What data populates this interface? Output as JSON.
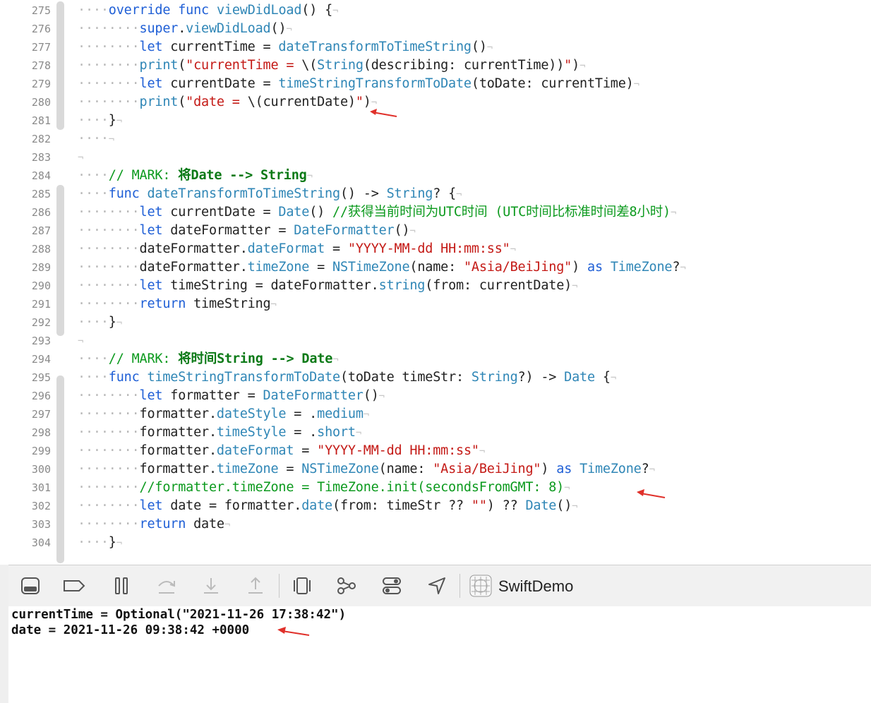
{
  "editor": {
    "lines": [
      {
        "n": "275",
        "tokens": [
          {
            "t": "····",
            "k": "ws"
          },
          {
            "t": "override",
            "k": "kw"
          },
          {
            "t": " ",
            "k": "pl"
          },
          {
            "t": "func",
            "k": "kw"
          },
          {
            "t": " ",
            "k": "pl"
          },
          {
            "t": "viewDidLoad",
            "k": "fn"
          },
          {
            "t": "() {",
            "k": "pl"
          },
          {
            "t": "¬",
            "k": "nl"
          }
        ]
      },
      {
        "n": "276",
        "tokens": [
          {
            "t": "········",
            "k": "ws"
          },
          {
            "t": "super",
            "k": "kw"
          },
          {
            "t": ".",
            "k": "pl"
          },
          {
            "t": "viewDidLoad",
            "k": "fn"
          },
          {
            "t": "()",
            "k": "pl"
          },
          {
            "t": "¬",
            "k": "nl"
          }
        ]
      },
      {
        "n": "277",
        "tokens": [
          {
            "t": "········",
            "k": "ws"
          },
          {
            "t": "let",
            "k": "kw"
          },
          {
            "t": " currentTime = ",
            "k": "pl"
          },
          {
            "t": "dateTransformToTimeString",
            "k": "fn"
          },
          {
            "t": "()",
            "k": "pl"
          },
          {
            "t": "¬",
            "k": "nl"
          }
        ]
      },
      {
        "n": "278",
        "tokens": [
          {
            "t": "········",
            "k": "ws"
          },
          {
            "t": "print",
            "k": "fn"
          },
          {
            "t": "(",
            "k": "pl"
          },
          {
            "t": "\"currentTime = ",
            "k": "str"
          },
          {
            "t": "\\(",
            "k": "pl"
          },
          {
            "t": "String",
            "k": "ty"
          },
          {
            "t": "(describing: currentTime))",
            "k": "pl"
          },
          {
            "t": "\"",
            "k": "str"
          },
          {
            "t": ")",
            "k": "pl"
          },
          {
            "t": "¬",
            "k": "nl"
          }
        ]
      },
      {
        "n": "279",
        "tokens": [
          {
            "t": "········",
            "k": "ws"
          },
          {
            "t": "let",
            "k": "kw"
          },
          {
            "t": " currentDate = ",
            "k": "pl"
          },
          {
            "t": "timeStringTransformToDate",
            "k": "fn"
          },
          {
            "t": "(toDate: currentTime)",
            "k": "pl"
          },
          {
            "t": "¬",
            "k": "nl"
          }
        ]
      },
      {
        "n": "280",
        "tokens": [
          {
            "t": "········",
            "k": "ws"
          },
          {
            "t": "print",
            "k": "fn"
          },
          {
            "t": "(",
            "k": "pl"
          },
          {
            "t": "\"date = ",
            "k": "str"
          },
          {
            "t": "\\(currentDate)",
            "k": "pl"
          },
          {
            "t": "\"",
            "k": "str"
          },
          {
            "t": ")",
            "k": "pl"
          },
          {
            "t": "¬",
            "k": "nl"
          }
        ]
      },
      {
        "n": "281",
        "tokens": [
          {
            "t": "····",
            "k": "ws"
          },
          {
            "t": "}",
            "k": "pl"
          },
          {
            "t": "¬",
            "k": "nl"
          }
        ]
      },
      {
        "n": "282",
        "tokens": [
          {
            "t": "····",
            "k": "ws"
          },
          {
            "t": "¬",
            "k": "nl"
          }
        ]
      },
      {
        "n": "283",
        "tokens": [
          {
            "t": "¬",
            "k": "nl"
          }
        ]
      },
      {
        "n": "284",
        "tokens": [
          {
            "t": "····",
            "k": "ws"
          },
          {
            "t": "// MARK: ",
            "k": "cm"
          },
          {
            "t": "将Date --> String",
            "k": "mk"
          },
          {
            "t": "¬",
            "k": "nl"
          }
        ]
      },
      {
        "n": "285",
        "tokens": [
          {
            "t": "····",
            "k": "ws"
          },
          {
            "t": "func",
            "k": "kw"
          },
          {
            "t": " ",
            "k": "pl"
          },
          {
            "t": "dateTransformToTimeString",
            "k": "fn"
          },
          {
            "t": "() -> ",
            "k": "pl"
          },
          {
            "t": "String",
            "k": "ty"
          },
          {
            "t": "? {",
            "k": "pl"
          },
          {
            "t": "¬",
            "k": "nl"
          }
        ]
      },
      {
        "n": "286",
        "tokens": [
          {
            "t": "········",
            "k": "ws"
          },
          {
            "t": "let",
            "k": "kw"
          },
          {
            "t": " currentDate = ",
            "k": "pl"
          },
          {
            "t": "Date",
            "k": "ty"
          },
          {
            "t": "() ",
            "k": "pl"
          },
          {
            "t": "//获得当前时间为UTC时间 (UTC时间比标准时间差8小时)",
            "k": "cm"
          },
          {
            "t": "¬",
            "k": "nl"
          }
        ]
      },
      {
        "n": "287",
        "tokens": [
          {
            "t": "········",
            "k": "ws"
          },
          {
            "t": "let",
            "k": "kw"
          },
          {
            "t": " dateFormatter = ",
            "k": "pl"
          },
          {
            "t": "DateFormatter",
            "k": "ty"
          },
          {
            "t": "()",
            "k": "pl"
          },
          {
            "t": "¬",
            "k": "nl"
          }
        ]
      },
      {
        "n": "288",
        "tokens": [
          {
            "t": "········",
            "k": "ws"
          },
          {
            "t": "dateFormatter.",
            "k": "pl"
          },
          {
            "t": "dateFormat",
            "k": "fn"
          },
          {
            "t": " = ",
            "k": "pl"
          },
          {
            "t": "\"YYYY-MM-dd HH:mm:ss\"",
            "k": "str"
          },
          {
            "t": "¬",
            "k": "nl"
          }
        ]
      },
      {
        "n": "289",
        "tokens": [
          {
            "t": "········",
            "k": "ws"
          },
          {
            "t": "dateFormatter.",
            "k": "pl"
          },
          {
            "t": "timeZone",
            "k": "fn"
          },
          {
            "t": " = ",
            "k": "pl"
          },
          {
            "t": "NSTimeZone",
            "k": "ty"
          },
          {
            "t": "(name: ",
            "k": "pl"
          },
          {
            "t": "\"Asia/BeiJing\"",
            "k": "str"
          },
          {
            "t": ") ",
            "k": "pl"
          },
          {
            "t": "as",
            "k": "kw"
          },
          {
            "t": " ",
            "k": "pl"
          },
          {
            "t": "TimeZone",
            "k": "ty"
          },
          {
            "t": "?",
            "k": "pl"
          },
          {
            "t": "¬",
            "k": "nl"
          }
        ]
      },
      {
        "n": "290",
        "tokens": [
          {
            "t": "········",
            "k": "ws"
          },
          {
            "t": "let",
            "k": "kw"
          },
          {
            "t": " timeString = dateFormatter.",
            "k": "pl"
          },
          {
            "t": "string",
            "k": "fn"
          },
          {
            "t": "(from: currentDate)",
            "k": "pl"
          },
          {
            "t": "¬",
            "k": "nl"
          }
        ]
      },
      {
        "n": "291",
        "tokens": [
          {
            "t": "········",
            "k": "ws"
          },
          {
            "t": "return",
            "k": "kw"
          },
          {
            "t": " timeString",
            "k": "pl"
          },
          {
            "t": "¬",
            "k": "nl"
          }
        ]
      },
      {
        "n": "292",
        "tokens": [
          {
            "t": "····",
            "k": "ws"
          },
          {
            "t": "}",
            "k": "pl"
          },
          {
            "t": "¬",
            "k": "nl"
          }
        ]
      },
      {
        "n": "293",
        "tokens": [
          {
            "t": "¬",
            "k": "nl"
          }
        ]
      },
      {
        "n": "294",
        "tokens": [
          {
            "t": "····",
            "k": "ws"
          },
          {
            "t": "// MARK: ",
            "k": "cm"
          },
          {
            "t": "将时间String --> Date",
            "k": "mk"
          },
          {
            "t": "¬",
            "k": "nl"
          }
        ]
      },
      {
        "n": "295",
        "tokens": [
          {
            "t": "····",
            "k": "ws"
          },
          {
            "t": "func",
            "k": "kw"
          },
          {
            "t": " ",
            "k": "pl"
          },
          {
            "t": "timeStringTransformToDate",
            "k": "fn"
          },
          {
            "t": "(toDate timeStr: ",
            "k": "pl"
          },
          {
            "t": "String",
            "k": "ty"
          },
          {
            "t": "?) -> ",
            "k": "pl"
          },
          {
            "t": "Date",
            "k": "ty"
          },
          {
            "t": " {",
            "k": "pl"
          },
          {
            "t": "¬",
            "k": "nl"
          }
        ]
      },
      {
        "n": "296",
        "tokens": [
          {
            "t": "········",
            "k": "ws"
          },
          {
            "t": "let",
            "k": "kw"
          },
          {
            "t": " formatter = ",
            "k": "pl"
          },
          {
            "t": "DateFormatter",
            "k": "ty"
          },
          {
            "t": "()",
            "k": "pl"
          },
          {
            "t": "¬",
            "k": "nl"
          }
        ]
      },
      {
        "n": "297",
        "tokens": [
          {
            "t": "········",
            "k": "ws"
          },
          {
            "t": "formatter.",
            "k": "pl"
          },
          {
            "t": "dateStyle",
            "k": "fn"
          },
          {
            "t": " = .",
            "k": "pl"
          },
          {
            "t": "medium",
            "k": "fn"
          },
          {
            "t": "¬",
            "k": "nl"
          }
        ]
      },
      {
        "n": "298",
        "tokens": [
          {
            "t": "········",
            "k": "ws"
          },
          {
            "t": "formatter.",
            "k": "pl"
          },
          {
            "t": "timeStyle",
            "k": "fn"
          },
          {
            "t": " = .",
            "k": "pl"
          },
          {
            "t": "short",
            "k": "fn"
          },
          {
            "t": "¬",
            "k": "nl"
          }
        ]
      },
      {
        "n": "299",
        "tokens": [
          {
            "t": "········",
            "k": "ws"
          },
          {
            "t": "formatter.",
            "k": "pl"
          },
          {
            "t": "dateFormat",
            "k": "fn"
          },
          {
            "t": " = ",
            "k": "pl"
          },
          {
            "t": "\"YYYY-MM-dd HH:mm:ss\"",
            "k": "str"
          },
          {
            "t": "¬",
            "k": "nl"
          }
        ]
      },
      {
        "n": "300",
        "tokens": [
          {
            "t": "········",
            "k": "ws"
          },
          {
            "t": "formatter.",
            "k": "pl"
          },
          {
            "t": "timeZone",
            "k": "fn"
          },
          {
            "t": " = ",
            "k": "pl"
          },
          {
            "t": "NSTimeZone",
            "k": "ty"
          },
          {
            "t": "(name: ",
            "k": "pl"
          },
          {
            "t": "\"Asia/BeiJing\"",
            "k": "str"
          },
          {
            "t": ") ",
            "k": "pl"
          },
          {
            "t": "as",
            "k": "kw"
          },
          {
            "t": " ",
            "k": "pl"
          },
          {
            "t": "TimeZone",
            "k": "ty"
          },
          {
            "t": "?",
            "k": "pl"
          },
          {
            "t": "¬",
            "k": "nl"
          }
        ]
      },
      {
        "n": "301",
        "tokens": [
          {
            "t": "········",
            "k": "ws"
          },
          {
            "t": "//formatter.timeZone = TimeZone.init(secondsFromGMT: 8)",
            "k": "cm"
          },
          {
            "t": "¬",
            "k": "nl"
          }
        ]
      },
      {
        "n": "302",
        "tokens": [
          {
            "t": "········",
            "k": "ws"
          },
          {
            "t": "let",
            "k": "kw"
          },
          {
            "t": " date = formatter.",
            "k": "pl"
          },
          {
            "t": "date",
            "k": "fn"
          },
          {
            "t": "(from: timeStr ?? ",
            "k": "pl"
          },
          {
            "t": "\"\"",
            "k": "str"
          },
          {
            "t": ") ?? ",
            "k": "pl"
          },
          {
            "t": "Date",
            "k": "ty"
          },
          {
            "t": "()",
            "k": "pl"
          },
          {
            "t": "¬",
            "k": "nl"
          }
        ]
      },
      {
        "n": "303",
        "tokens": [
          {
            "t": "········",
            "k": "ws"
          },
          {
            "t": "return",
            "k": "kw"
          },
          {
            "t": " date",
            "k": "pl"
          },
          {
            "t": "¬",
            "k": "nl"
          }
        ]
      },
      {
        "n": "304",
        "tokens": [
          {
            "t": "····",
            "k": "ws"
          },
          {
            "t": "}",
            "k": "pl"
          },
          {
            "t": "¬",
            "k": "nl"
          }
        ]
      }
    ]
  },
  "debug_bar": {
    "buttons": [
      {
        "name": "hide-debug-area-icon"
      },
      {
        "name": "breakpoints-toggle-icon"
      },
      {
        "name": "pause-icon"
      },
      {
        "name": "step-over-icon"
      },
      {
        "name": "step-into-icon"
      },
      {
        "name": "step-out-icon"
      },
      {
        "name": "debug-view-hierarchy-icon"
      },
      {
        "name": "memory-graph-icon"
      },
      {
        "name": "environment-overrides-icon"
      },
      {
        "name": "simulate-location-icon"
      }
    ],
    "scheme_name": "SwiftDemo"
  },
  "console": {
    "lines": [
      "currentTime = Optional(\"2021-11-26 17:38:42\")",
      "date = 2021-11-26 09:38:42 +0000"
    ]
  },
  "colors": {
    "keyword": "#1f5fd6",
    "type": "#2f86b6",
    "string": "#c41a16",
    "comment": "#0c9a1e",
    "annotation_arrow": "#e0302a"
  }
}
